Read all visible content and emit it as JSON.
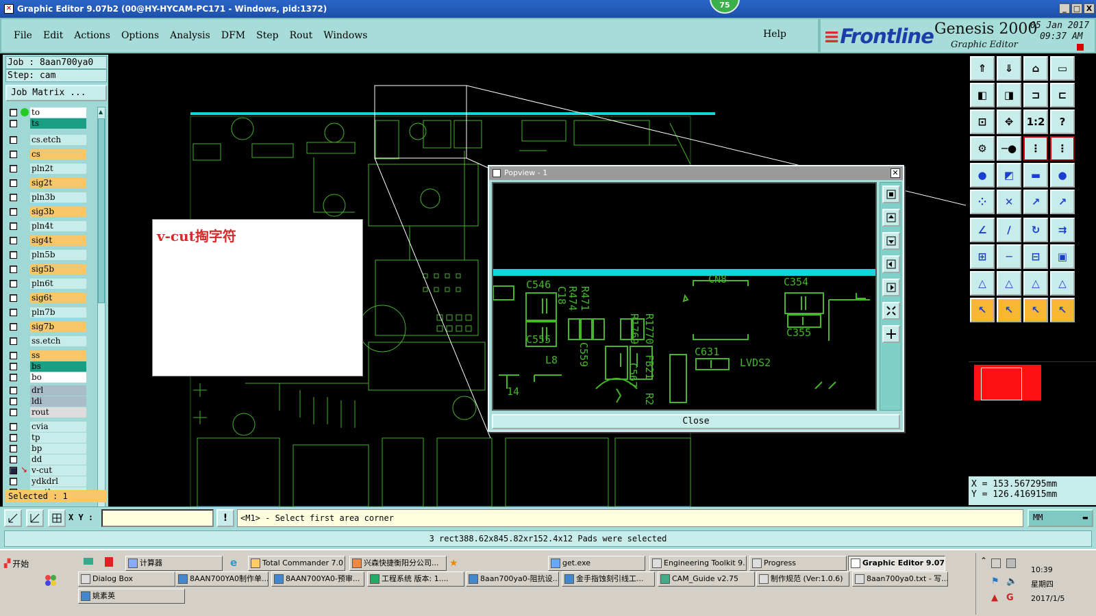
{
  "window": {
    "title": "Graphic Editor 9.07b2 (00@HY-HYCAM-PC171 - Windows, pid:1372)",
    "badge": "75",
    "buttons": [
      "_",
      "□",
      "X"
    ]
  },
  "menu": {
    "items": [
      "File",
      "Edit",
      "Actions",
      "Options",
      "Analysis",
      "DFM",
      "Step",
      "Rout",
      "Windows"
    ],
    "help": "Help"
  },
  "brand": {
    "logo": "Frontline",
    "product": "Genesis 2000",
    "subtitle": "Graphic Editor",
    "date": "05 Jan 2017",
    "time": "09:37 AM"
  },
  "job": {
    "job_line": "Job : 8aan700ya0",
    "step_line": "Step: cam",
    "matrix_button": "Job Matrix ...",
    "selected": "Selected : 1"
  },
  "layers": [
    {
      "name": "to",
      "color": "#ffffff"
    },
    {
      "name": "ts",
      "color": "#1a9e86"
    },
    {
      "name": "cs.etch",
      "color": "#c8ecea"
    },
    {
      "name": "cs",
      "color": "#f7c76a"
    },
    {
      "name": "pln2t",
      "color": "#c8ecea"
    },
    {
      "name": "sig2t",
      "color": "#f7c76a"
    },
    {
      "name": "pln3b",
      "color": "#c8ecea"
    },
    {
      "name": "sig3b",
      "color": "#f7c76a"
    },
    {
      "name": "pln4t",
      "color": "#c8ecea"
    },
    {
      "name": "sig4t",
      "color": "#f7c76a"
    },
    {
      "name": "pln5b",
      "color": "#c8ecea"
    },
    {
      "name": "sig5b",
      "color": "#f7c76a"
    },
    {
      "name": "pln6t",
      "color": "#c8ecea"
    },
    {
      "name": "sig6t",
      "color": "#f7c76a"
    },
    {
      "name": "pln7b",
      "color": "#c8ecea"
    },
    {
      "name": "sig7b",
      "color": "#f7c76a"
    },
    {
      "name": "ss.etch",
      "color": "#c8ecea"
    },
    {
      "name": "ss",
      "color": "#f7c76a"
    },
    {
      "name": "bs",
      "color": "#1a9e86"
    },
    {
      "name": "bo",
      "color": "#ffffff"
    },
    {
      "name": "drl",
      "color": "#a9bcc9"
    },
    {
      "name": "ldi",
      "color": "#a9bcc9"
    },
    {
      "name": "rout",
      "color": "#dcdcdc"
    },
    {
      "name": "cvia",
      "color": "#c8ecea"
    },
    {
      "name": "tp",
      "color": "#c8ecea"
    },
    {
      "name": "bp",
      "color": "#c8ecea"
    },
    {
      "name": "dd",
      "color": "#c8ecea"
    },
    {
      "name": "v-cut",
      "color": "#c8ecea"
    },
    {
      "name": "ydkdrl",
      "color": "#c8ecea"
    },
    {
      "name": "mpth",
      "color": "#c8ecea"
    }
  ],
  "note": {
    "text": "v-cut掏字符"
  },
  "popview": {
    "title": "Popview - 1",
    "close_label": "Close",
    "labels": [
      "C546",
      "C18",
      "R474",
      "R471",
      "C555",
      "L8",
      "C559",
      "C567",
      "R1769",
      "R1770",
      "FB21",
      "R2",
      "CN8",
      "C354",
      "C355",
      "C631",
      "LVDS2",
      "14"
    ]
  },
  "coords": {
    "x": "X  =  153.567295mm",
    "y": "Y  =  126.416915mm"
  },
  "bottom": {
    "xy_label": "X Y :",
    "xy_value": "",
    "message": "<M1> - Select first area corner",
    "unit": "MM",
    "status": "3 rect388.62x845.82xr152.4x12 Pads were selected"
  },
  "taskbar": {
    "start": "开始",
    "buttons": [
      {
        "label": "计算器"
      },
      {
        "label": "Total Commander 7.0 ..."
      },
      {
        "label": "兴森快捷衡阳分公司..."
      },
      {
        "label": "get.exe"
      },
      {
        "label": "Engineering Toolkit 9...."
      },
      {
        "label": "Progress"
      },
      {
        "label": "Graphic Editor 9.07..."
      },
      {
        "label": "Dialog Box"
      },
      {
        "label": "8AAN700YA0制作单..."
      },
      {
        "label": "8AAN700YA0-预审..."
      },
      {
        "label": "工程系统  版本: 1...."
      },
      {
        "label": "8aan700ya0-阻抗设..."
      },
      {
        "label": "金手指蚀刻引线工..."
      },
      {
        "label": "CAM_Guide v2.75"
      },
      {
        "label": "制作规范 (Ver:1.0.6)"
      },
      {
        "label": "8aan700ya0.txt - 写..."
      },
      {
        "label": "姚素英"
      }
    ],
    "clock_time": "10:39",
    "clock_day": "星期四",
    "clock_date": "2017/1/5"
  }
}
